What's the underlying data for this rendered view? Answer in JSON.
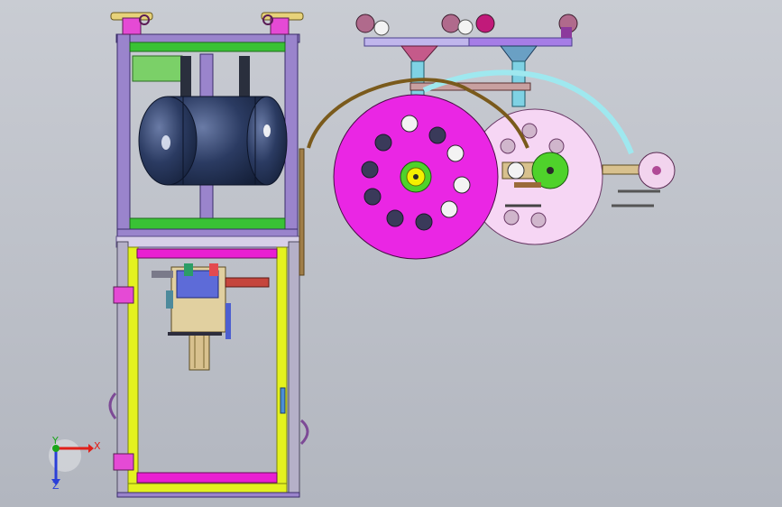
{
  "viewport": {
    "background_top": "#c9ccd3",
    "background_bottom": "#b2b6bf"
  },
  "triad": {
    "x_label": "X",
    "y_label": "Y",
    "z_label": "Z",
    "x_color": "#e0201a",
    "y_color": "#1aa51a",
    "z_color": "#2a3fd8"
  },
  "colors": {
    "frame_purple": "#9a84cc",
    "frame_green": "#39c235",
    "frame_yellow": "#e4f21f",
    "frame_magenta": "#e91fd2",
    "tank_dark": "#1c2c4f",
    "tank_light": "#5d6f97",
    "disk_magenta": "#ea26e4",
    "disk_pink": "#f6d6f4",
    "hub_green": "#4fd22b",
    "hub_yellow": "#f4f000",
    "arc_brown": "#7a5a1c",
    "arc_cyan": "#9fe8ef",
    "base_plate": "#d8c18e"
  }
}
